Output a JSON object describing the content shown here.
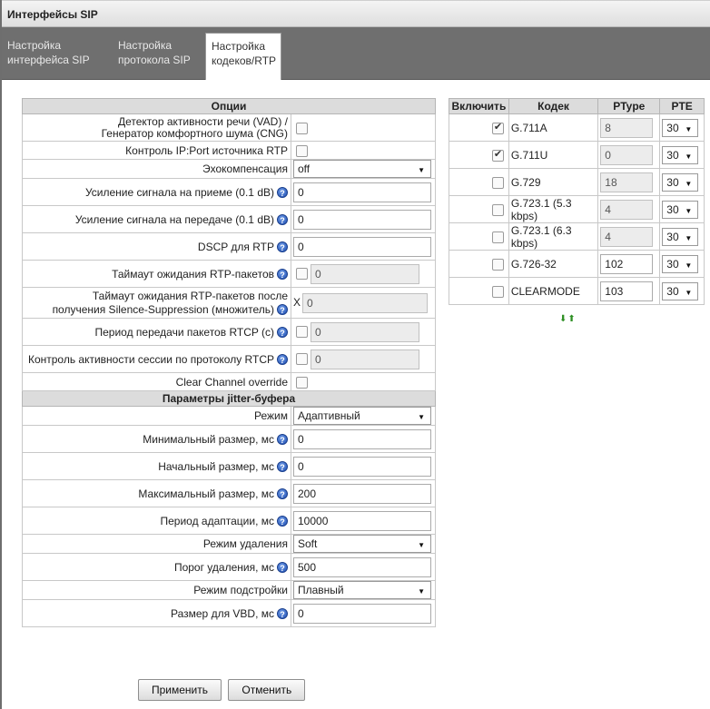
{
  "window": {
    "title": "Интерфейсы SIP"
  },
  "tabs": [
    {
      "label": "Настройка\nинтерфейса SIP"
    },
    {
      "label": "Настройка\nпротокола SIP"
    },
    {
      "label": "Настройка\nкодеков/RTP"
    }
  ],
  "options": {
    "header": "Опции",
    "vad_label": "Детектор активности речи (VAD) /\nГенератор комфортного шума (CNG)",
    "ipport_label": "Контроль IP:Port источника RTP",
    "echo_label": "Эхокомпенсация",
    "echo_value": "off",
    "rx_gain_label": "Усиление сигнала на приеме (0.1 dB)",
    "rx_gain_value": "0",
    "tx_gain_label": "Усиление сигнала на передаче (0.1 dB)",
    "tx_gain_value": "0",
    "dscp_label": "DSCP для RTP",
    "dscp_value": "0",
    "rtp_timeout_label": "Таймаут ожидания RTP-пакетов",
    "rtp_timeout_value": "0",
    "rtp_ss_label": "Таймаут ожидания RTP-пакетов после\nполучения Silence-Suppression (множитель)",
    "rtp_ss_prefix": "X",
    "rtp_ss_value": "0",
    "rtcp_period_label": "Период передачи пакетов RTCP (с)",
    "rtcp_period_value": "0",
    "rtcp_ctrl_label": "Контроль активности сессии по протоколу RTCP",
    "rtcp_ctrl_value": "0",
    "clear_channel_label": "Clear Channel override"
  },
  "jitter": {
    "header": "Параметры jitter-буфера",
    "mode_label": "Режим",
    "mode_value": "Адаптивный",
    "min_label": "Минимальный размер, мс",
    "min_value": "0",
    "init_label": "Начальный размер, мс",
    "init_value": "0",
    "max_label": "Максимальный размер, мс",
    "max_value": "200",
    "adapt_label": "Период адаптации, мс",
    "adapt_value": "10000",
    "del_mode_label": "Режим удаления",
    "del_mode_value": "Soft",
    "del_thr_label": "Порог удаления, мс",
    "del_thr_value": "500",
    "tune_label": "Режим подстройки",
    "tune_value": "Плавный",
    "vbd_label": "Размер для VBD, мс",
    "vbd_value": "0"
  },
  "codecs": {
    "headers": {
      "enable": "Включить",
      "codec": "Кодек",
      "ptype": "PType",
      "pte": "PTE"
    },
    "rows": [
      {
        "enabled": true,
        "name": "G.711A",
        "ptype": "8",
        "pte": "30"
      },
      {
        "enabled": true,
        "name": "G.711U",
        "ptype": "0",
        "pte": "30"
      },
      {
        "enabled": false,
        "name": "G.729",
        "ptype": "18",
        "pte": "30"
      },
      {
        "enabled": false,
        "name": "G.723.1 (5.3 kbps)",
        "ptype": "4",
        "pte": "30"
      },
      {
        "enabled": false,
        "name": "G.723.1 (6.3 kbps)",
        "ptype": "4",
        "pte": "30"
      },
      {
        "enabled": false,
        "name": "G.726-32",
        "ptype": "102",
        "pte": "30"
      },
      {
        "enabled": false,
        "name": "CLEARMODE",
        "ptype": "103",
        "pte": "30"
      }
    ]
  },
  "buttons": {
    "apply": "Применить",
    "cancel": "Отменить"
  },
  "colors": {
    "tab_bar": "#6f6f6f",
    "section_header": "#dcdcdc",
    "help_icon": "#1f4fb3",
    "arrows": "#2d8f23"
  },
  "icons": {
    "help": "question-circle-icon",
    "reorder": "arrow-down-up-icon"
  }
}
